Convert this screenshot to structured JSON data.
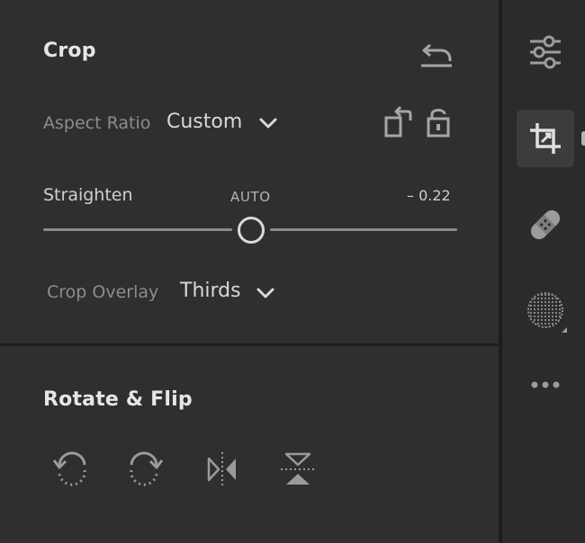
{
  "crop": {
    "title": "Crop",
    "aspect_ratio_label": "Aspect Ratio",
    "aspect_ratio_value": "Custom",
    "straighten_label": "Straighten",
    "straighten_auto": "AUTO",
    "straighten_value": "– 0.22",
    "overlay_label": "Crop Overlay",
    "overlay_value": "Thirds"
  },
  "rotate": {
    "title": "Rotate & Flip"
  },
  "icons": {
    "reset": "reset-arrow-icon",
    "chevron": "chevron-down-icon",
    "rotate_aspect": "rotate-aspect-icon",
    "lock": "unlock-icon",
    "rotate_left": "rotate-left-icon",
    "rotate_right": "rotate-right-icon",
    "flip_horizontal": "flip-horizontal-icon",
    "flip_vertical": "flip-vertical-icon",
    "edit_sliders": "sliders-icon",
    "crop_tool": "crop-icon",
    "heal_tool": "bandage-icon",
    "mask_tool": "mask-icon",
    "more": "more-icon"
  },
  "colors": {
    "panel_bg": "#2f2f2f",
    "toolbar_bg": "#2b2b2b",
    "active_tool_bg": "#3c3c3c",
    "text": "#d6d6d6",
    "muted_text": "#8d8d8d"
  },
  "slider": {
    "straighten_fraction": 0.5
  }
}
